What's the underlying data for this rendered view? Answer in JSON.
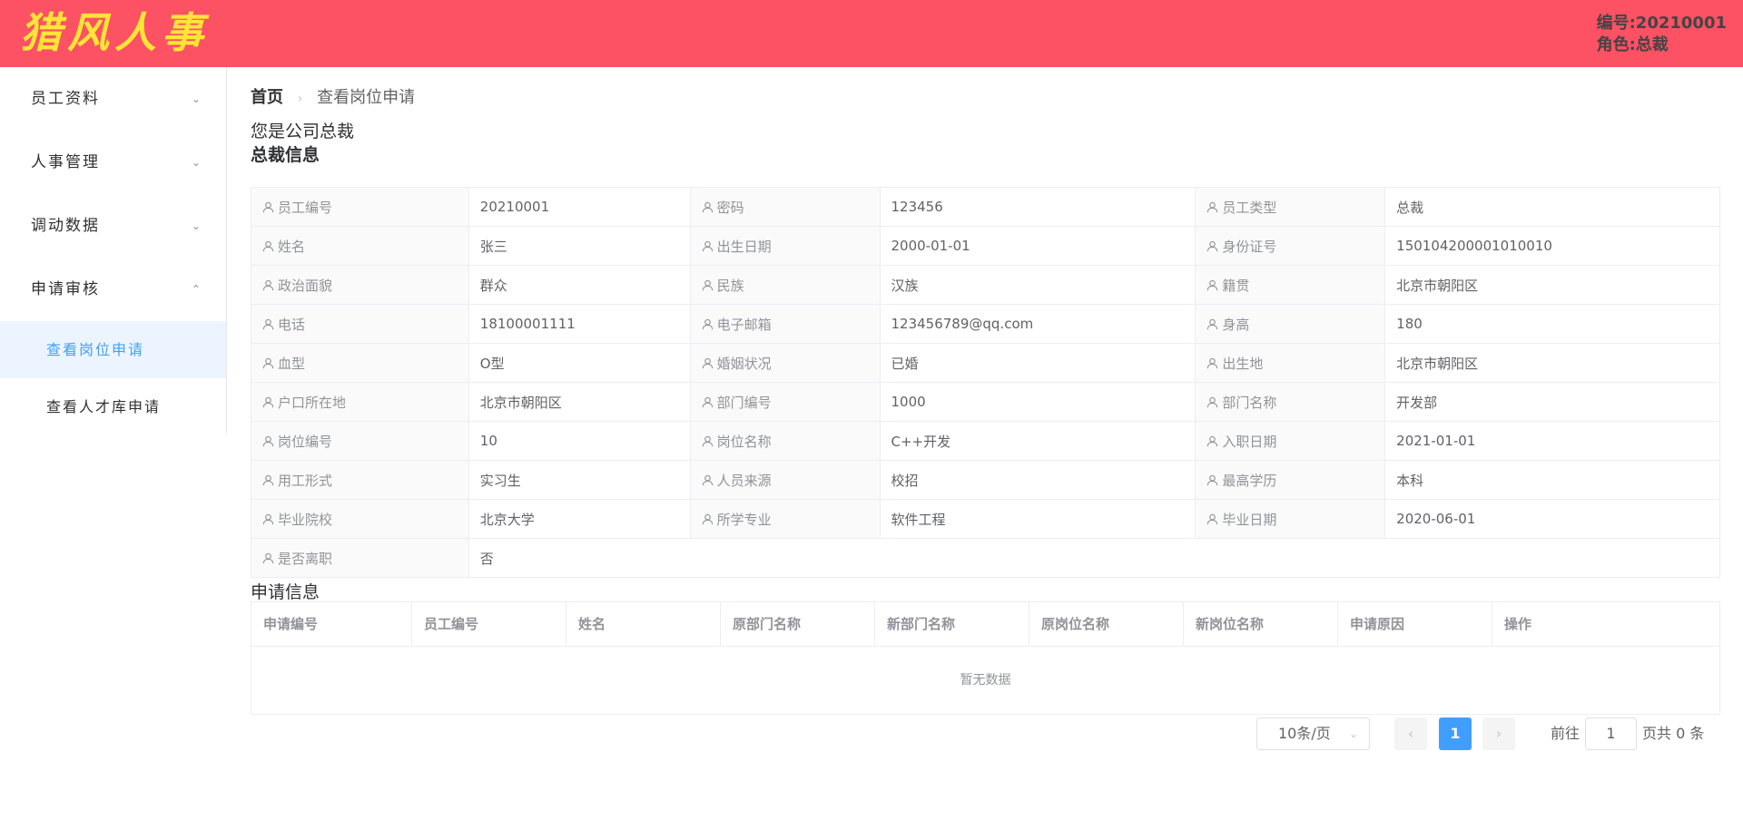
{
  "header": {
    "logo": "猎风人事",
    "user_id": "编号:20210001",
    "user_role": "角色:总裁"
  },
  "sidebar": {
    "menus": [
      {
        "label": "员工资料",
        "expanded": false
      },
      {
        "label": "人事管理",
        "expanded": false
      },
      {
        "label": "调动数据",
        "expanded": false
      },
      {
        "label": "申请审核",
        "expanded": true
      }
    ],
    "sub_items": [
      {
        "label": "查看岗位申请",
        "active": true
      },
      {
        "label": "查看人才库申请",
        "active": false
      }
    ]
  },
  "breadcrumb": {
    "home": "首页",
    "current": "查看岗位申请"
  },
  "role_line": "您是公司总裁",
  "info_title": "总裁信息",
  "info_rows": [
    [
      {
        "label": "员工编号",
        "value": "20210001"
      },
      {
        "label": "密码",
        "value": "123456"
      },
      {
        "label": "员工类型",
        "value": "总裁"
      }
    ],
    [
      {
        "label": "姓名",
        "value": "张三"
      },
      {
        "label": "出生日期",
        "value": "2000-01-01"
      },
      {
        "label": "身份证号",
        "value": "150104200001010010"
      }
    ],
    [
      {
        "label": "政治面貌",
        "value": "群众"
      },
      {
        "label": "民族",
        "value": "汉族"
      },
      {
        "label": "籍贯",
        "value": "北京市朝阳区"
      }
    ],
    [
      {
        "label": "电话",
        "value": "18100001111"
      },
      {
        "label": "电子邮箱",
        "value": "123456789@qq.com"
      },
      {
        "label": "身高",
        "value": "180"
      }
    ],
    [
      {
        "label": "血型",
        "value": "O型"
      },
      {
        "label": "婚姻状况",
        "value": "已婚"
      },
      {
        "label": "出生地",
        "value": "北京市朝阳区"
      }
    ],
    [
      {
        "label": "户口所在地",
        "value": "北京市朝阳区"
      },
      {
        "label": "部门编号",
        "value": "1000"
      },
      {
        "label": "部门名称",
        "value": "开发部"
      }
    ],
    [
      {
        "label": "岗位编号",
        "value": "10"
      },
      {
        "label": "岗位名称",
        "value": "C++开发"
      },
      {
        "label": "入职日期",
        "value": "2021-01-01"
      }
    ],
    [
      {
        "label": "用工形式",
        "value": "实习生"
      },
      {
        "label": "人员来源",
        "value": "校招"
      },
      {
        "label": "最高学历",
        "value": "本科"
      }
    ],
    [
      {
        "label": "毕业院校",
        "value": "北京大学"
      },
      {
        "label": "所学专业",
        "value": "软件工程"
      },
      {
        "label": "毕业日期",
        "value": "2020-06-01"
      }
    ],
    [
      {
        "label": "是否离职",
        "value": "否"
      }
    ]
  ],
  "apply_title": "申请信息",
  "apply_columns": [
    "申请编号",
    "员工编号",
    "姓名",
    "原部门名称",
    "新部门名称",
    "原岗位名称",
    "新岗位名称",
    "申请原因",
    "操作"
  ],
  "apply_empty": "暂无数据",
  "pagination": {
    "page_size": "10条/页",
    "current_page": "1",
    "goto_label": "前往",
    "goto_value": "1",
    "total_text": "页共 0 条"
  },
  "colors": {
    "header_bg": "#fd5164",
    "logo": "#ffe536",
    "accent": "#409eff"
  }
}
